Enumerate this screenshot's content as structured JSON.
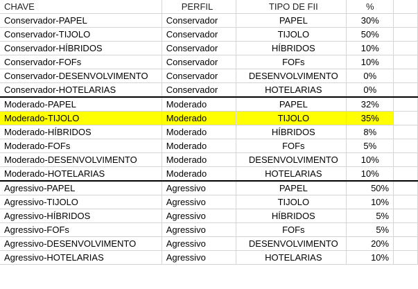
{
  "columns": [
    "CHAVE",
    "PERFIL",
    "TIPO DE FII",
    "%"
  ],
  "groups": [
    {
      "rows": [
        {
          "chave": "Conservador-PAPEL",
          "perfil": "Conservador",
          "tipo": "PAPEL",
          "pct": "30%"
        },
        {
          "chave": "Conservador-TIJOLO",
          "perfil": "Conservador",
          "tipo": "TIJOLO",
          "pct": "50%"
        },
        {
          "chave": "Conservador-HÍBRIDOS",
          "perfil": "Conservador",
          "tipo": "HÍBRIDOS",
          "pct": "10%"
        },
        {
          "chave": "Conservador-FOFs",
          "perfil": "Conservador",
          "tipo": "FOFs",
          "pct": "10%"
        },
        {
          "chave": "Conservador-DESENVOLVIMENTO",
          "perfil": "Conservador",
          "tipo": "DESENVOLVIMENTO",
          "pct": "0%"
        },
        {
          "chave": "Conservador-HOTELARIAS",
          "perfil": "Conservador",
          "tipo": "HOTELARIAS",
          "pct": "0%"
        }
      ]
    },
    {
      "rows": [
        {
          "chave": "Moderado-PAPEL",
          "perfil": "Moderado",
          "tipo": "PAPEL",
          "pct": "32%"
        },
        {
          "chave": "Moderado-TIJOLO",
          "perfil": "Moderado",
          "tipo": "TIJOLO",
          "pct": "35%",
          "highlight": true
        },
        {
          "chave": "Moderado-HÍBRIDOS",
          "perfil": "Moderado",
          "tipo": "HÍBRIDOS",
          "pct": "8%"
        },
        {
          "chave": "Moderado-FOFs",
          "perfil": "Moderado",
          "tipo": "FOFs",
          "pct": "5%"
        },
        {
          "chave": "Moderado-DESENVOLVIMENTO",
          "perfil": "Moderado",
          "tipo": "DESENVOLVIMENTO",
          "pct": "10%"
        },
        {
          "chave": "Moderado-HOTELARIAS",
          "perfil": "Moderado",
          "tipo": "HOTELARIAS",
          "pct": "10%"
        }
      ]
    },
    {
      "pct_align": "right",
      "rows": [
        {
          "chave": "Agressivo-PAPEL",
          "perfil": "Agressivo",
          "tipo": "PAPEL",
          "pct": "50%"
        },
        {
          "chave": "Agressivo-TIJOLO",
          "perfil": "Agressivo",
          "tipo": "TIJOLO",
          "pct": "10%"
        },
        {
          "chave": "Agressivo-HÍBRIDOS",
          "perfil": "Agressivo",
          "tipo": "HÍBRIDOS",
          "pct": "5%"
        },
        {
          "chave": "Agressivo-FOFs",
          "perfil": "Agressivo",
          "tipo": "FOFs",
          "pct": "5%"
        },
        {
          "chave": "Agressivo-DESENVOLVIMENTO",
          "perfil": "Agressivo",
          "tipo": "DESENVOLVIMENTO",
          "pct": "20%"
        },
        {
          "chave": "Agressivo-HOTELARIAS",
          "perfil": "Agressivo",
          "tipo": "HOTELARIAS",
          "pct": "10%"
        }
      ]
    }
  ],
  "colors": {
    "highlight": "#ffff00",
    "gridline": "#d4d4d4",
    "group_separator": "#000000"
  }
}
